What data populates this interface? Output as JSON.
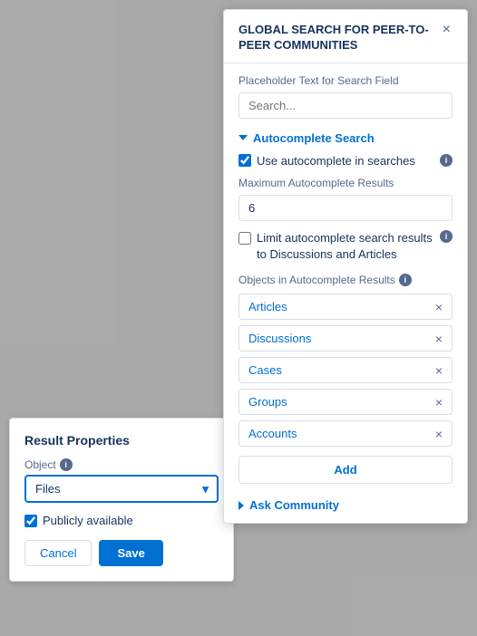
{
  "overlay": {
    "background": "rgba(0,0,0,0.3)"
  },
  "leftPanel": {
    "title": "Result Properties",
    "objectLabel": "Object",
    "objectValue": "Files",
    "publiclyAvailableLabel": "Publicly available",
    "cancelLabel": "Cancel",
    "saveLabel": "Save"
  },
  "rightPanel": {
    "title": "GLOBAL SEARCH FOR PEER-TO-PEER COMMUNITIES",
    "close": "×",
    "placeholderLabel": "Placeholder Text for Search Field",
    "searchPlaceholder": "Search...",
    "autocomplete": {
      "sectionTitle": "Autocomplete Search",
      "useAutocompleteLabel": "Use autocomplete in searches",
      "maxResultsLabel": "Maximum Autocomplete Results",
      "maxResultsValue": "6",
      "limitLabel": "Limit autocomplete search results to Discussions and Articles"
    },
    "objectsLabel": "Objects in Autocomplete Results",
    "tags": [
      {
        "label": "Articles"
      },
      {
        "label": "Discussions"
      },
      {
        "label": "Cases"
      },
      {
        "label": "Groups"
      },
      {
        "label": "Accounts"
      }
    ],
    "addLabel": "Add",
    "askCommunity": {
      "label": "Ask Community"
    }
  }
}
